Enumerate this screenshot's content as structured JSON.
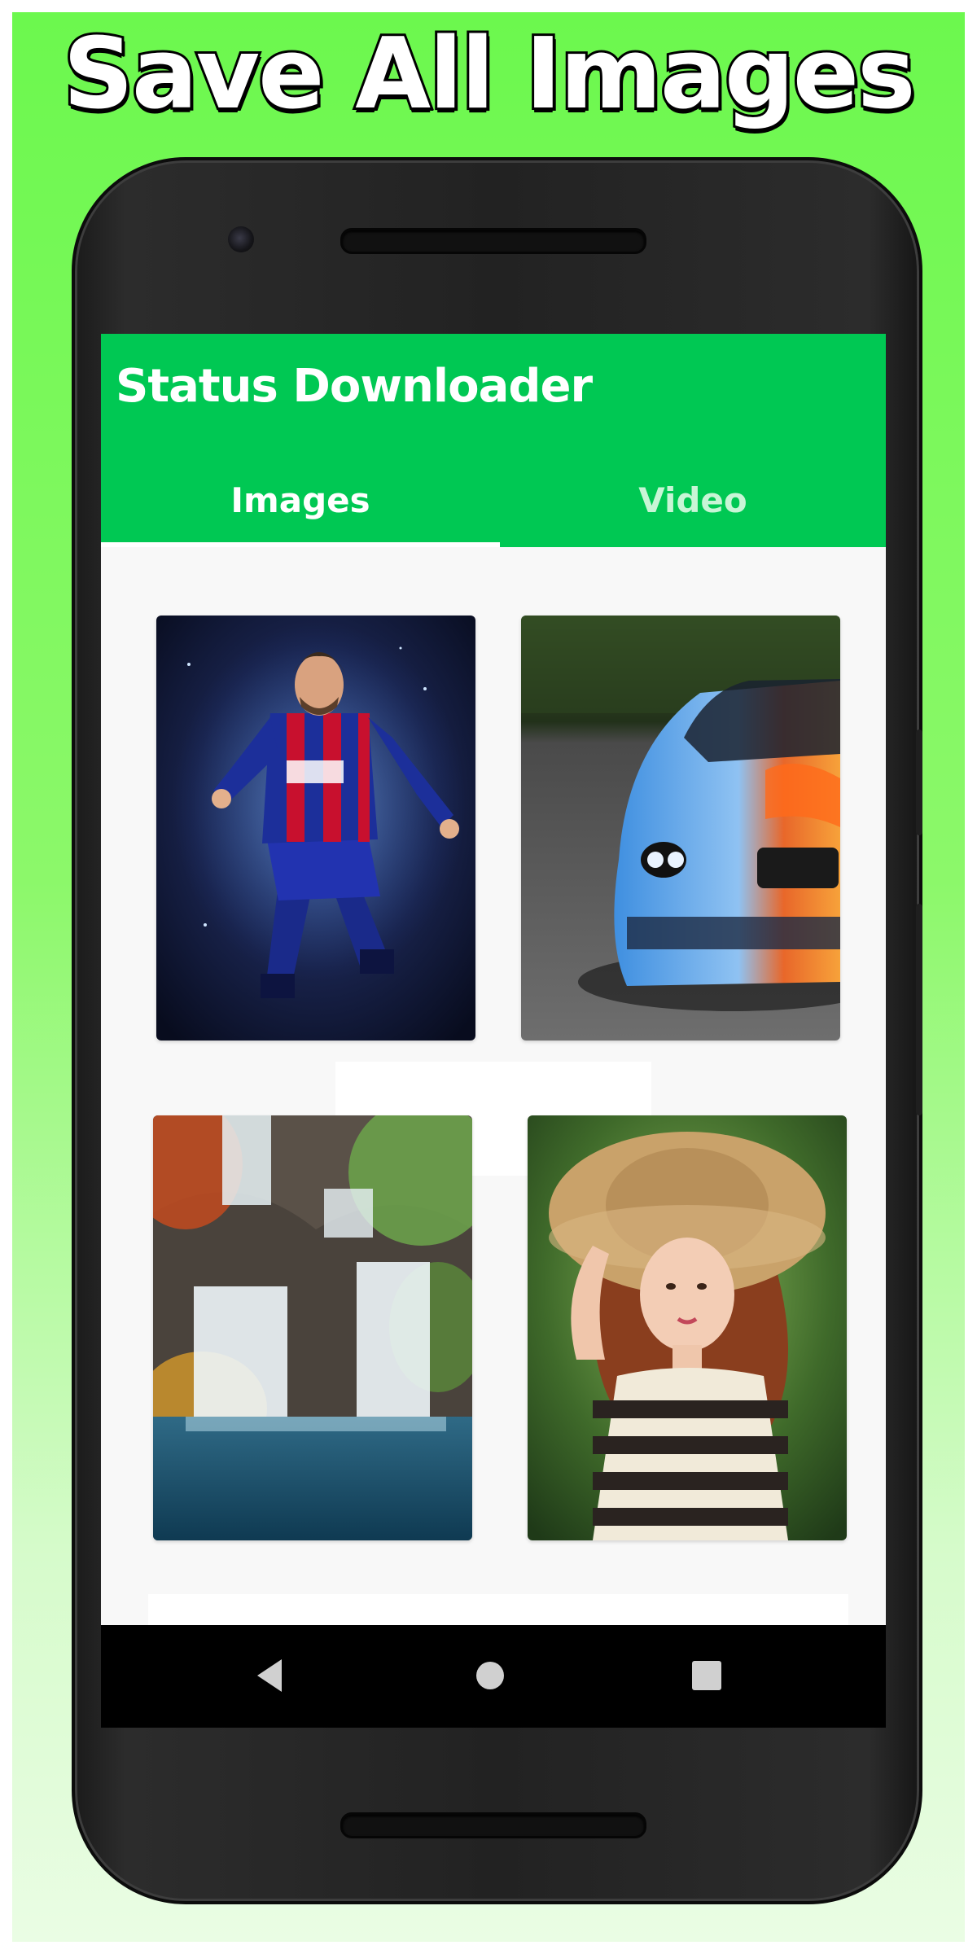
{
  "promo": {
    "headline": "Save All Images",
    "background_top": "#6cf84e",
    "background_bottom": "#eafde4"
  },
  "app": {
    "title": "Status Downloader",
    "accent_color": "#00c853",
    "tabs": [
      {
        "label": "Images",
        "selected": true
      },
      {
        "label": "Video",
        "selected": false
      }
    ]
  },
  "gallery": {
    "items": [
      {
        "subject": "soccer player in red and blue striped kit"
      },
      {
        "subject": "blue and orange painted sports car"
      },
      {
        "subject": "waterfall with autumn trees"
      },
      {
        "subject": "woman in straw hat and striped shirt"
      }
    ]
  },
  "navigation": {
    "buttons": [
      {
        "icon": "back-triangle-icon"
      },
      {
        "icon": "home-circle-icon"
      },
      {
        "icon": "recents-square-icon"
      }
    ]
  }
}
